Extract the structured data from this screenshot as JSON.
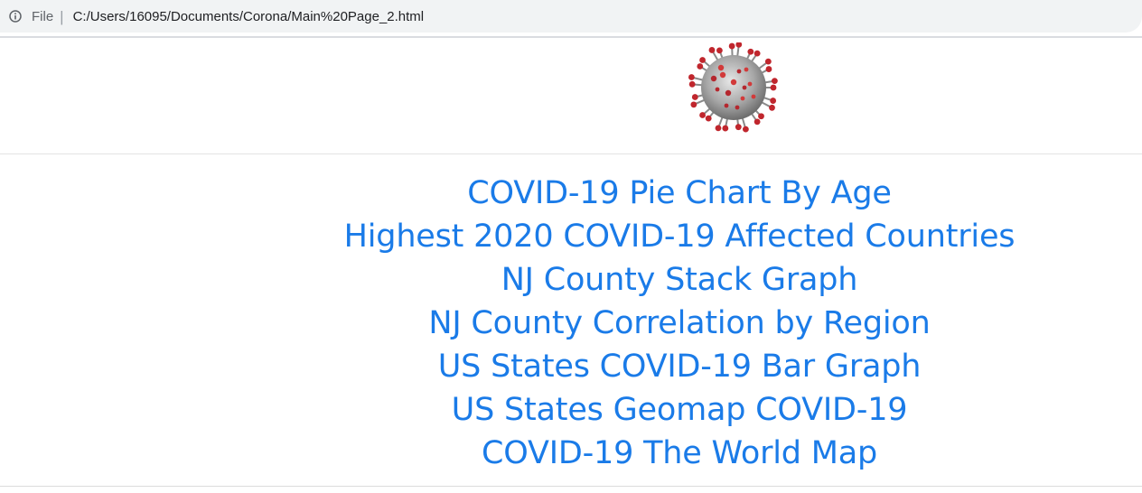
{
  "browser": {
    "file_label": "File",
    "url": "C:/Users/16095/Documents/Corona/Main%20Page_2.html"
  },
  "header": {
    "image_icon": "coronavirus-icon"
  },
  "nav": {
    "links": [
      "COVID-19 Pie Chart By Age",
      "Highest 2020 COVID-19 Affected Countries",
      "NJ County Stack Graph",
      "NJ County Correlation by Region",
      "US States COVID-19 Bar Graph",
      "US States Geomap COVID-19",
      "COVID-19 The World Map"
    ]
  },
  "colors": {
    "link": "#1a7be8",
    "virus_body": "#a9a9a9",
    "virus_spike": "#c0262d"
  }
}
